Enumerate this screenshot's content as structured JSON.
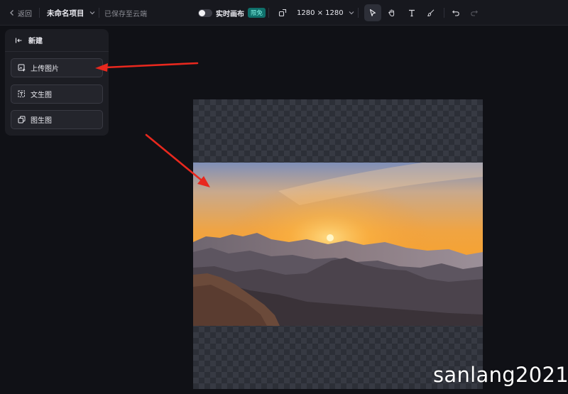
{
  "toolbar": {
    "back_label": "返回",
    "project_name": "未命名项目",
    "saved_status": "已保存至云端",
    "realtime_canvas_label": "实时画布",
    "limited_badge": "限免",
    "canvas_size": "1280 × 1280",
    "icons": [
      "chevron-left-icon",
      "chevron-down-icon",
      "resize-icon",
      "select-arrow-icon",
      "hand-icon",
      "text-icon",
      "brush-icon",
      "undo-icon",
      "redo-icon"
    ]
  },
  "panel": {
    "header": "新建",
    "items": [
      {
        "label": "上传图片",
        "icon": "upload-image-icon"
      },
      {
        "label": "文生图",
        "icon": "text-to-image-icon"
      },
      {
        "label": "图生图",
        "icon": "image-to-image-icon"
      }
    ]
  },
  "colors": {
    "app_background": "#101116",
    "toolbar_background": "#17181e",
    "panel_background": "#1c1d23",
    "badge_color": "#0f6f6a",
    "arrow_color": "#e8281e"
  },
  "watermark": "sanlang2021"
}
